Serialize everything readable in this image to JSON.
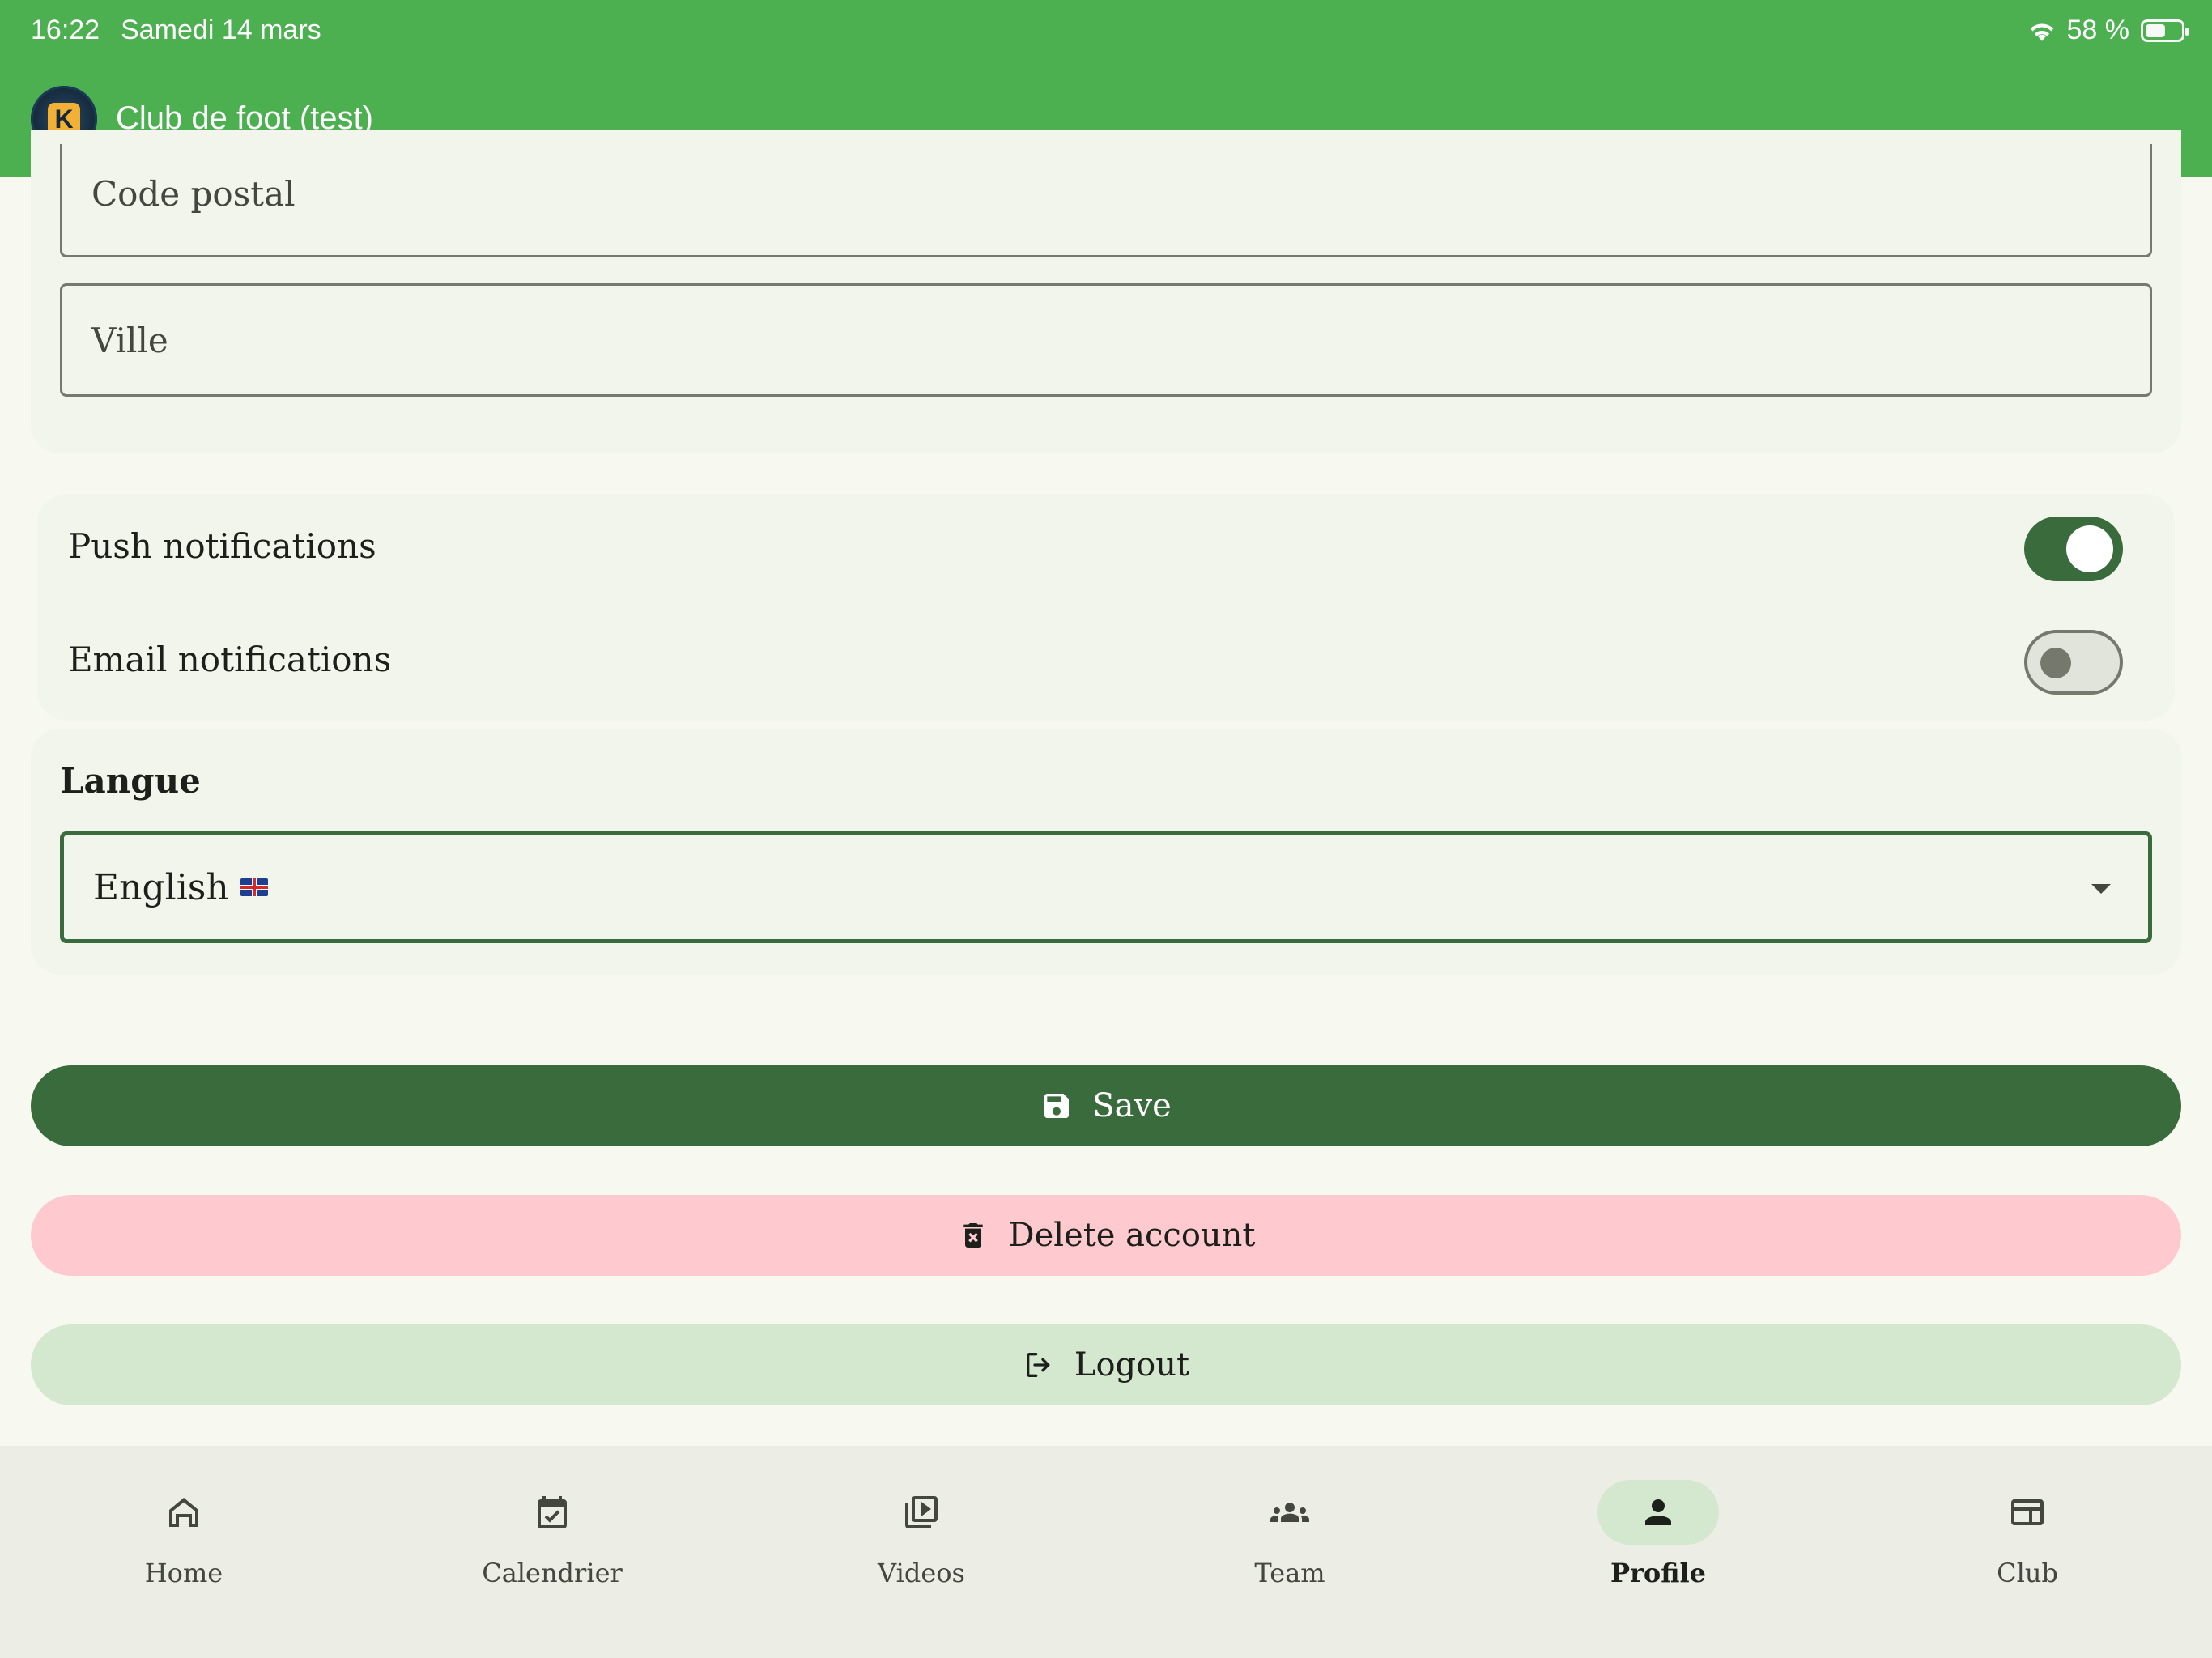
{
  "status_bar": {
    "time": "16:22",
    "date": "Samedi 14 mars",
    "battery": "58 %"
  },
  "header": {
    "title": "Club de foot (test)",
    "logo_letter": "K"
  },
  "address": {
    "postal_placeholder": "Code postal",
    "city_placeholder": "Ville"
  },
  "notifications": {
    "push_label": "Push notifications",
    "push_enabled": true,
    "email_label": "Email notifications",
    "email_enabled": false
  },
  "language": {
    "label": "Langue",
    "selected": "English"
  },
  "actions": {
    "save_label": "Save",
    "delete_label": "Delete account",
    "logout_label": "Logout"
  },
  "nav": {
    "items": [
      {
        "label": "Home",
        "icon": "home-icon"
      },
      {
        "label": "Calendrier",
        "icon": "calendar-icon"
      },
      {
        "label": "Videos",
        "icon": "video-library-icon"
      },
      {
        "label": "Team",
        "icon": "groups-icon"
      },
      {
        "label": "Profile",
        "icon": "person-icon",
        "active": true
      },
      {
        "label": "Club",
        "icon": "club-icon"
      }
    ]
  },
  "colors": {
    "topbar": "#4caf50",
    "primary": "#3a6b3c",
    "danger_container": "#ffcacf",
    "secondary_container": "#d4e7cf"
  }
}
